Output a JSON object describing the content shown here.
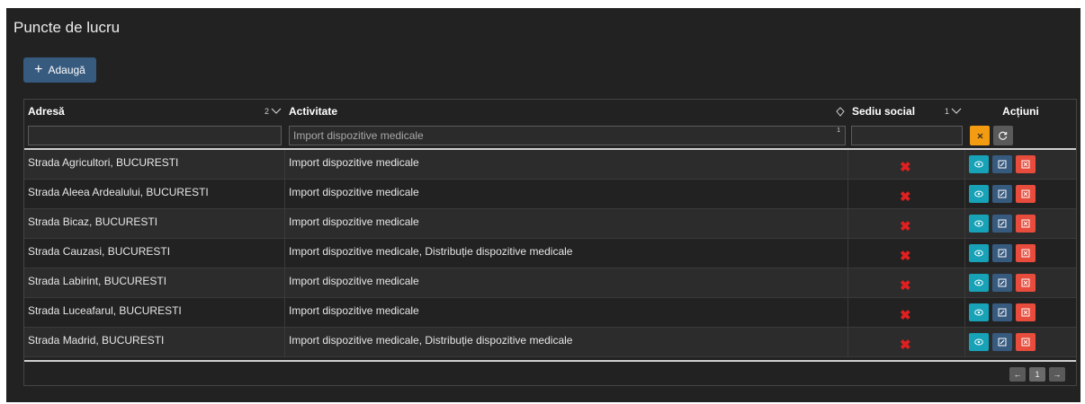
{
  "page": {
    "title": "Puncte de lucru"
  },
  "toolbar": {
    "add_label": "Adaugă",
    "add_icon": "plus-icon"
  },
  "table": {
    "columns": [
      {
        "label": "Adresă",
        "sort_order": "2"
      },
      {
        "label": "Activitate",
        "sort_order": ""
      },
      {
        "label": "Sediu social",
        "sort_order": "1"
      },
      {
        "label": "Acțiuni",
        "sort_order": ""
      }
    ],
    "filters": {
      "adresa": "",
      "activitate": "Import dispozitive medicale",
      "activitate_badge": "1",
      "sediu_social": ""
    },
    "rows": [
      {
        "adresa": "Strada Agricultori, BUCURESTI",
        "activitate": "Import dispozitive medicale",
        "sediu_social": "✖"
      },
      {
        "adresa": "Strada Aleea Ardealului, BUCURESTI",
        "activitate": "Import dispozitive medicale",
        "sediu_social": "✖"
      },
      {
        "adresa": "Strada Bicaz, BUCURESTI",
        "activitate": "Import dispozitive medicale",
        "sediu_social": "✖"
      },
      {
        "adresa": "Strada Cauzasi, BUCURESTI",
        "activitate": "Import dispozitive medicale, Distribuție dispozitive medicale",
        "sediu_social": "✖"
      },
      {
        "adresa": "Strada Labirint, BUCURESTI",
        "activitate": "Import dispozitive medicale",
        "sediu_social": "✖"
      },
      {
        "adresa": "Strada Luceafarul, BUCURESTI",
        "activitate": "Import dispozitive medicale",
        "sediu_social": "✖"
      },
      {
        "adresa": "Strada Madrid, BUCURESTI",
        "activitate": "Import dispozitive medicale, Distribuție dispozitive medicale",
        "sediu_social": "✖"
      }
    ]
  },
  "pagination": {
    "prev": "←",
    "current": "1",
    "next": "→"
  },
  "colors": {
    "panel_bg": "#222222",
    "add_button": "#375a7f",
    "view": "#17a2b8",
    "edit": "#375a7f",
    "delete": "#e74c3c",
    "clear_filter": "#f39c12",
    "reset": "#5a5a5a",
    "no_mark": "#e02020"
  }
}
